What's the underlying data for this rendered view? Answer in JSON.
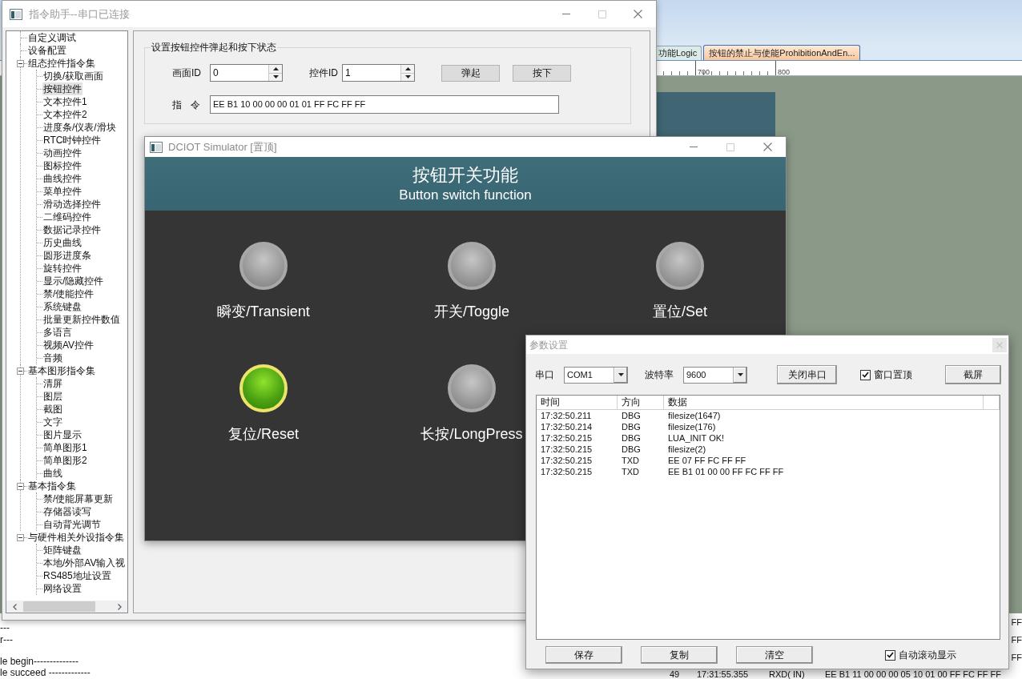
{
  "background_app": {
    "tabs": [
      {
        "label": "功能Logic",
        "selected": false
      },
      {
        "label": "按钮的禁止与使能ProhibitionAndEn...",
        "selected": true
      }
    ],
    "ruler_labels": [
      "700",
      "800"
    ],
    "console_lines": [
      "---",
      "r---",
      "le begin--------------",
      "le succeed -------------"
    ],
    "log_rows": [
      {
        "cells": [
          "FF"
        ]
      },
      {
        "cells": [
          "FF"
        ]
      },
      {
        "cells": [
          "FF"
        ]
      },
      {
        "cells": [
          "49",
          "17:31:55.355",
          "RXD( IN)",
          "EE B1 11 00 00 00 05 10 01 00 FF FC FF FF"
        ]
      }
    ]
  },
  "command_window": {
    "title": "指令助手--串口已连接",
    "tree": [
      {
        "label": "自定义调试",
        "selected": false
      },
      {
        "label": "设备配置",
        "selected": false
      },
      {
        "label": "组态控件指令集",
        "selected": false,
        "expanded": true,
        "children": [
          {
            "label": "切换/获取画面",
            "selected": false
          },
          {
            "label": "按钮控件",
            "selected": true
          },
          {
            "label": "文本控件1",
            "selected": false
          },
          {
            "label": "文本控件2",
            "selected": false
          },
          {
            "label": "进度条/仪表/滑块",
            "selected": false
          },
          {
            "label": "RTC时钟控件",
            "selected": false
          },
          {
            "label": "动画控件",
            "selected": false
          },
          {
            "label": "图标控件",
            "selected": false
          },
          {
            "label": "曲线控件",
            "selected": false
          },
          {
            "label": "菜单控件",
            "selected": false
          },
          {
            "label": "滑动选择控件",
            "selected": false
          },
          {
            "label": "二维码控件",
            "selected": false
          },
          {
            "label": "数据记录控件",
            "selected": false
          },
          {
            "label": "历史曲线",
            "selected": false
          },
          {
            "label": "圆形进度条",
            "selected": false
          },
          {
            "label": "旋转控件",
            "selected": false
          },
          {
            "label": "显示/隐藏控件",
            "selected": false
          },
          {
            "label": "禁/使能控件",
            "selected": false
          },
          {
            "label": "系统键盘",
            "selected": false
          },
          {
            "label": "批量更新控件数值",
            "selected": false
          },
          {
            "label": "多语言",
            "selected": false
          },
          {
            "label": "视频AV控件",
            "selected": false
          },
          {
            "label": "音频",
            "selected": false
          }
        ]
      },
      {
        "label": "基本图形指令集",
        "selected": false,
        "expanded": true,
        "children": [
          {
            "label": "清屏",
            "selected": false
          },
          {
            "label": "图层",
            "selected": false
          },
          {
            "label": "截图",
            "selected": false
          },
          {
            "label": "文字",
            "selected": false
          },
          {
            "label": "图片显示",
            "selected": false
          },
          {
            "label": "简单图形1",
            "selected": false
          },
          {
            "label": "简单图形2",
            "selected": false
          },
          {
            "label": "曲线",
            "selected": false
          }
        ]
      },
      {
        "label": "基本指令集",
        "selected": false,
        "expanded": true,
        "children": [
          {
            "label": "禁/使能屏幕更新",
            "selected": false
          },
          {
            "label": "存储器读写",
            "selected": false
          },
          {
            "label": "自动背光调节",
            "selected": false
          }
        ]
      },
      {
        "label": "与硬件相关外设指令集",
        "selected": false,
        "expanded": true,
        "children": [
          {
            "label": "矩阵键盘",
            "selected": false
          },
          {
            "label": "本地/外部AV输入视",
            "selected": false
          },
          {
            "label": "RS485地址设置",
            "selected": false
          },
          {
            "label": "网络设置",
            "selected": false
          }
        ]
      }
    ],
    "group": {
      "title": "设置按钮控件弹起和按下状态",
      "fields": [
        {
          "label": "画面ID",
          "value": "0"
        },
        {
          "label": "控件ID",
          "value": "1"
        }
      ],
      "buttons": [
        "弹起",
        "按下"
      ],
      "command": {
        "label": "指 令",
        "value": "EE B1 10 00 00 00 01 01 FF FC FF FF"
      }
    }
  },
  "simulator": {
    "title": "DCIOT Simulator [置顶]",
    "heading": "按钮开关功能",
    "subheading": "Button switch function",
    "buttons": [
      {
        "label": "瞬变/Transient",
        "on": false
      },
      {
        "label": "开关/Toggle",
        "on": false
      },
      {
        "label": "置位/Set",
        "on": false
      },
      {
        "label": "复位/Reset",
        "on": true
      },
      {
        "label": "长按/LongPress",
        "on": false
      }
    ]
  },
  "params_dialog": {
    "title": "参数设置",
    "selects": [
      {
        "label": "串口",
        "value": "COM1"
      },
      {
        "label": "波特率",
        "value": "9600"
      }
    ],
    "close_port_button": "关闭串口",
    "topmost": {
      "label": "窗口置顶",
      "checked": true
    },
    "screenshot_button": "截屏",
    "log": {
      "columns": [
        "时间",
        "方向",
        "数据"
      ],
      "rows": [
        {
          "time": "17:32:50.211",
          "direction": "DBG",
          "data": "filesize(1647)"
        },
        {
          "time": "17:32:50.214",
          "direction": "DBG",
          "data": "filesize(176)"
        },
        {
          "time": "17:32:50.215",
          "direction": "DBG",
          "data": "LUA_INIT OK!"
        },
        {
          "time": "17:32:50.215",
          "direction": "DBG",
          "data": "filesize(2)"
        },
        {
          "time": "17:32:50.215",
          "direction": "TXD",
          "data": "EE 07 FF FC FF FF"
        },
        {
          "time": "17:32:50.215",
          "direction": "TXD",
          "data": "EE B1 01 00 00 FF FC FF FF"
        }
      ]
    },
    "buttons": [
      "保存",
      "复制",
      "清空"
    ],
    "auto_scroll": {
      "label": "自动滚动显示",
      "checked": true
    }
  }
}
